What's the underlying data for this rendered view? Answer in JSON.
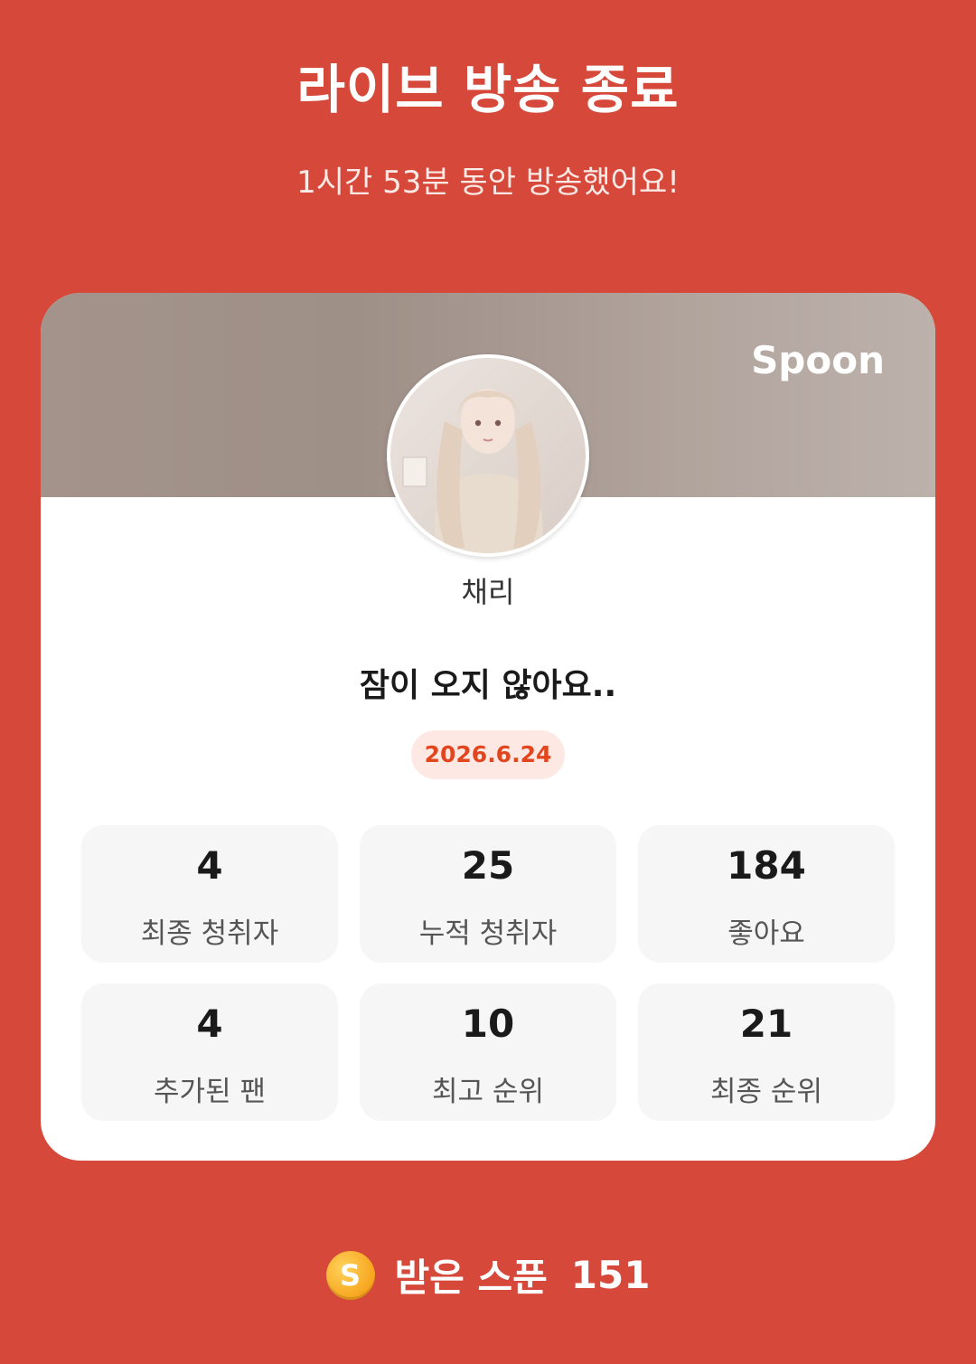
{
  "header": {
    "title": "라이브 방송 종료",
    "subtitle": "1시간 53분 동안 방송했어요!"
  },
  "card": {
    "brand": "Spoon",
    "nickname": "채리",
    "broadcast_title": "잠이 오지 않아요..",
    "date": "2026.6.24",
    "stats": [
      {
        "value": "4",
        "label": "최종 청취자"
      },
      {
        "value": "25",
        "label": "누적 청취자"
      },
      {
        "value": "184",
        "label": "좋아요"
      },
      {
        "value": "4",
        "label": "추가된 팬"
      },
      {
        "value": "10",
        "label": "최고 순위"
      },
      {
        "value": "21",
        "label": "최종 순위"
      }
    ]
  },
  "footer": {
    "coin_icon": "S",
    "label": "받은 스푼",
    "count": "151"
  },
  "colors": {
    "background": "#d6483a",
    "accent": "#e2461f",
    "card": "#ffffff"
  }
}
